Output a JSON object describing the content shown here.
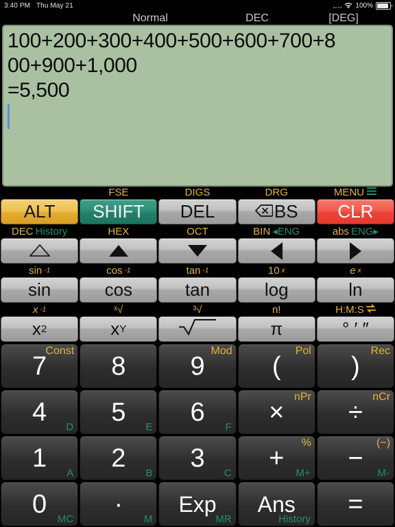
{
  "statusbar": {
    "time": "3:40 PM",
    "date": "Thu May 21",
    "battery_percent": "100%",
    "wifi_icon": "wifi-icon",
    "battery_icon": "battery-icon"
  },
  "mode_row": {
    "display_mode": "Normal",
    "number_base": "DEC",
    "angle_unit": "[DEG]"
  },
  "display": {
    "lines": [
      "100+200+300+400+500+600+700+8",
      "00+900+1,000",
      "=5,500"
    ],
    "expression": "100+200+300+400+500+600+700+800+900+1,000",
    "result": "=5,500",
    "background_color": "#a9c0a1",
    "cursor_color": "#5b8ed6"
  },
  "colors": {
    "gold_label": "#e3b33c",
    "teal_label": "#1f8e74",
    "alt_key": "#eec253",
    "shift_key": "#2f8f78",
    "clear_key": "#ec4438"
  },
  "function_rows": [
    {
      "keys": [
        {
          "label": "",
          "main": "ALT",
          "style": "alt",
          "icon": null
        },
        {
          "label": "FSE",
          "main": "SHIFT",
          "style": "shift",
          "icon": null
        },
        {
          "label": "DIGS",
          "main": "DEL",
          "style": "gray",
          "icon": null
        },
        {
          "label": "DRG",
          "main": "BS",
          "style": "gray",
          "icon": "backspace-icon"
        },
        {
          "label": "MENU",
          "label_icon": "hamburger-menu-icon",
          "main": "CLR",
          "style": "clr",
          "icon": null
        }
      ]
    },
    {
      "keys": [
        {
          "label": "DEC",
          "label_alt": "History",
          "main": "",
          "style": "gray",
          "icon": "triangle-up-outline-icon"
        },
        {
          "label": "HEX",
          "main": "",
          "style": "gray",
          "icon": "triangle-up-icon"
        },
        {
          "label": "OCT",
          "main": "",
          "style": "gray",
          "icon": "triangle-down-icon"
        },
        {
          "label": "BIN",
          "label_alt": "◂ENG",
          "main": "",
          "style": "gray",
          "icon": "triangle-left-icon"
        },
        {
          "label": "abs",
          "label_alt": "ENG▸",
          "main": "",
          "style": "gray",
          "icon": "triangle-right-icon"
        }
      ]
    },
    {
      "keys": [
        {
          "label": "sin",
          "label_sup": "-1",
          "main": "sin",
          "style": "gray"
        },
        {
          "label": "cos",
          "label_sup": "-1",
          "main": "cos",
          "style": "gray"
        },
        {
          "label": "tan",
          "label_sup": "-1",
          "main": "tan",
          "style": "gray"
        },
        {
          "label": "10",
          "label_sup": "x",
          "main": "log",
          "style": "gray"
        },
        {
          "label": "e",
          "label_sup": "x",
          "main": "ln",
          "style": "gray"
        }
      ]
    },
    {
      "keys": [
        {
          "label": "x",
          "label_sup": "-1",
          "main": "x",
          "main_sup": "2",
          "style": "gray"
        },
        {
          "label": "ˣ√",
          "main": "x",
          "main_sup": "Y",
          "style": "gray"
        },
        {
          "label": "³√",
          "main": "√",
          "style": "gray"
        },
        {
          "label": "n!",
          "main": "π",
          "style": "gray"
        },
        {
          "label": "H:M:S",
          "label_icon": "swap-arrows-icon",
          "main": "° ′ ″",
          "style": "gray"
        }
      ]
    }
  ],
  "numeric_rows": [
    [
      {
        "main": "7",
        "top": "Const",
        "bottom": ""
      },
      {
        "main": "8",
        "top": "",
        "bottom": ""
      },
      {
        "main": "9",
        "top": "Mod",
        "bottom": ""
      },
      {
        "main": "(",
        "top": "Pol",
        "bottom": ""
      },
      {
        "main": ")",
        "top": "Rec",
        "bottom": ""
      }
    ],
    [
      {
        "main": "4",
        "top": "",
        "bottom": "D"
      },
      {
        "main": "5",
        "top": "",
        "bottom": "E"
      },
      {
        "main": "6",
        "top": "",
        "bottom": "F"
      },
      {
        "main": "×",
        "top": "nPr",
        "bottom": ""
      },
      {
        "main": "÷",
        "top": "nCr",
        "bottom": ""
      }
    ],
    [
      {
        "main": "1",
        "top": "",
        "bottom": "A"
      },
      {
        "main": "2",
        "top": "",
        "bottom": "B"
      },
      {
        "main": "3",
        "top": "",
        "bottom": "C"
      },
      {
        "main": "+",
        "top": "%",
        "bottom": "M+"
      },
      {
        "main": "−",
        "top": "(−)",
        "bottom": "M-"
      }
    ],
    [
      {
        "main": "0",
        "top": "",
        "bottom": "MC"
      },
      {
        "main": "·",
        "top": "",
        "bottom": "M"
      },
      {
        "main": "Exp",
        "top": "",
        "bottom": "MR",
        "small": true
      },
      {
        "main": "Ans",
        "top": "",
        "bottom": "History",
        "small": true
      },
      {
        "main": "=",
        "top": "",
        "bottom": ""
      }
    ]
  ]
}
